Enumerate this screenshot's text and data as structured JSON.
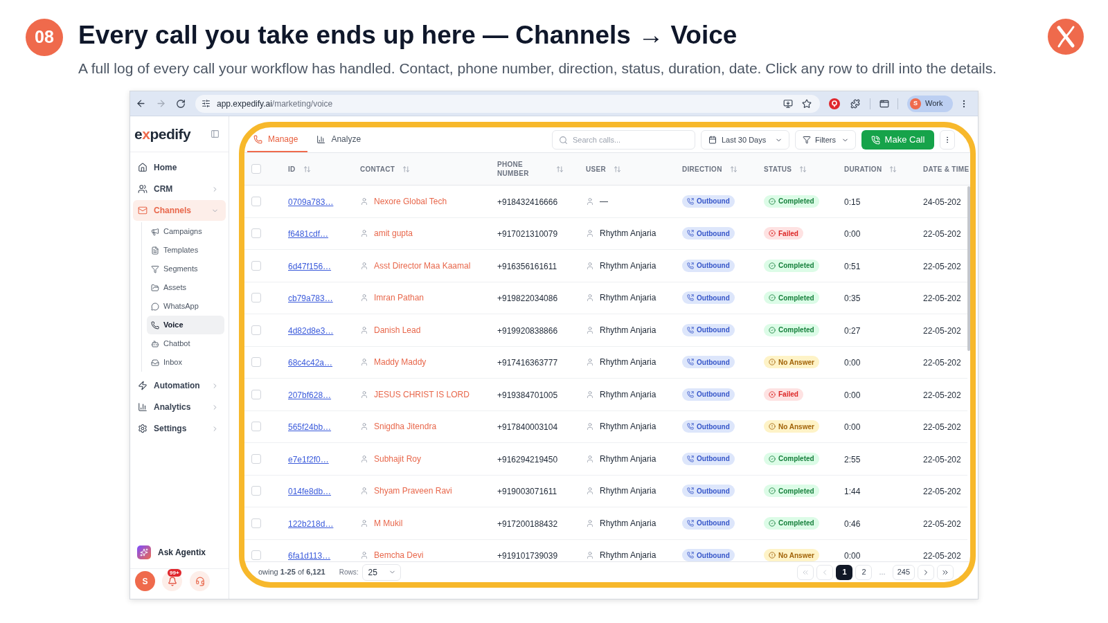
{
  "slide": {
    "number": "08",
    "title": "Every call you take ends up here — Channels → Voice",
    "subtitle": "A full log of every call your workflow has handled. Contact, phone number, direction, status, duration, date. Click any row to drill into the details."
  },
  "browser": {
    "back": {
      "disabled": false
    },
    "forward": {
      "disabled": true
    },
    "url_host": "app.expedify.ai",
    "url_path": "/marketing/voice",
    "profile": {
      "initial": "S",
      "label": "Work"
    }
  },
  "sidebar": {
    "logo": "expedify",
    "items": [
      {
        "label": "Home",
        "kind": "link",
        "selected": false
      },
      {
        "label": "CRM",
        "kind": "group",
        "selected": false,
        "expanded": false
      },
      {
        "label": "Channels",
        "kind": "group",
        "selected": true,
        "expanded": true,
        "children": [
          {
            "label": "Campaigns",
            "selected": false
          },
          {
            "label": "Templates",
            "selected": false
          },
          {
            "label": "Segments",
            "selected": false
          },
          {
            "label": "Assets",
            "selected": false
          },
          {
            "label": "WhatsApp",
            "selected": false
          },
          {
            "label": "Voice",
            "selected": true
          },
          {
            "label": "Chatbot",
            "selected": false
          },
          {
            "label": "Inbox",
            "selected": false
          }
        ]
      },
      {
        "label": "Automation",
        "kind": "group",
        "selected": false,
        "expanded": false
      },
      {
        "label": "Analytics",
        "kind": "group",
        "selected": false,
        "expanded": false
      },
      {
        "label": "Settings",
        "kind": "group",
        "selected": false,
        "expanded": false
      }
    ],
    "ask_label": "Ask Agentix",
    "user_initial": "S",
    "notification_count": "99+"
  },
  "main": {
    "tabs": [
      {
        "label": "Manage",
        "selected": true
      },
      {
        "label": "Analyze",
        "selected": false
      }
    ],
    "search": {
      "placeholder": "Search calls..."
    },
    "date_range": "Last 30 Days",
    "filters": "Filters",
    "make_call": "Make Call"
  },
  "table": {
    "select_all": {
      "checked": false
    },
    "columns": [
      {
        "label": "ID",
        "sortable": true
      },
      {
        "label": "CONTACT",
        "sortable": true
      },
      {
        "label": "PHONE NUMBER",
        "sortable": true
      },
      {
        "label": "USER",
        "sortable": true
      },
      {
        "label": "DIRECTION",
        "sortable": true
      },
      {
        "label": "STATUS",
        "sortable": true
      },
      {
        "label": "DURATION",
        "sortable": true
      },
      {
        "label": "DATE & TIME",
        "sortable": false
      }
    ],
    "rows": [
      {
        "checked": false,
        "id": "0709a783…",
        "contact": "Nexore Global Tech",
        "phone": "+918432416666",
        "user": "—",
        "direction": {
          "label": "Outbound",
          "kind": "outbound"
        },
        "status": {
          "label": "Completed",
          "kind": "completed"
        },
        "duration": "0:15",
        "date": "24-05-202"
      },
      {
        "checked": false,
        "id": "f6481cdf…",
        "contact": "amit gupta",
        "phone": "+917021310079",
        "user": "Rhythm Anjaria",
        "direction": {
          "label": "Outbound",
          "kind": "outbound"
        },
        "status": {
          "label": "Failed",
          "kind": "failed"
        },
        "duration": "0:00",
        "date": "22-05-202"
      },
      {
        "checked": false,
        "id": "6d47f156…",
        "contact": "Asst Director Maa Kaamal",
        "phone": "+916356161611",
        "user": "Rhythm Anjaria",
        "direction": {
          "label": "Outbound",
          "kind": "outbound"
        },
        "status": {
          "label": "Completed",
          "kind": "completed"
        },
        "duration": "0:51",
        "date": "22-05-202"
      },
      {
        "checked": false,
        "id": "cb79a783…",
        "contact": "Imran Pathan",
        "phone": "+919822034086",
        "user": "Rhythm Anjaria",
        "direction": {
          "label": "Outbound",
          "kind": "outbound"
        },
        "status": {
          "label": "Completed",
          "kind": "completed"
        },
        "duration": "0:35",
        "date": "22-05-202"
      },
      {
        "checked": false,
        "id": "4d82d8e3…",
        "contact": "Danish Lead",
        "phone": "+919920838866",
        "user": "Rhythm Anjaria",
        "direction": {
          "label": "Outbound",
          "kind": "outbound"
        },
        "status": {
          "label": "Completed",
          "kind": "completed"
        },
        "duration": "0:27",
        "date": "22-05-202"
      },
      {
        "checked": false,
        "id": "68c4c42a…",
        "contact": "Maddy Maddy",
        "phone": "+917416363777",
        "user": "Rhythm Anjaria",
        "direction": {
          "label": "Outbound",
          "kind": "outbound"
        },
        "status": {
          "label": "No Answer",
          "kind": "no_answer"
        },
        "duration": "0:00",
        "date": "22-05-202"
      },
      {
        "checked": false,
        "id": "207bf628…",
        "contact": "JESUS CHRIST IS LORD",
        "phone": "+919384701005",
        "user": "Rhythm Anjaria",
        "direction": {
          "label": "Outbound",
          "kind": "outbound"
        },
        "status": {
          "label": "Failed",
          "kind": "failed"
        },
        "duration": "0:00",
        "date": "22-05-202"
      },
      {
        "checked": false,
        "id": "565f24bb…",
        "contact": "Snigdha Jitendra",
        "phone": "+917840003104",
        "user": "Rhythm Anjaria",
        "direction": {
          "label": "Outbound",
          "kind": "outbound"
        },
        "status": {
          "label": "No Answer",
          "kind": "no_answer"
        },
        "duration": "0:00",
        "date": "22-05-202"
      },
      {
        "checked": false,
        "id": "e7e1f2f0…",
        "contact": "Subhajit Roy",
        "phone": "+916294219450",
        "user": "Rhythm Anjaria",
        "direction": {
          "label": "Outbound",
          "kind": "outbound"
        },
        "status": {
          "label": "Completed",
          "kind": "completed"
        },
        "duration": "2:55",
        "date": "22-05-202"
      },
      {
        "checked": false,
        "id": "014fe8db…",
        "contact": "Shyam Praveen Ravi",
        "phone": "+919003071611",
        "user": "Rhythm Anjaria",
        "direction": {
          "label": "Outbound",
          "kind": "outbound"
        },
        "status": {
          "label": "Completed",
          "kind": "completed"
        },
        "duration": "1:44",
        "date": "22-05-202"
      },
      {
        "checked": false,
        "id": "122b218d…",
        "contact": "M Mukil",
        "phone": "+917200188432",
        "user": "Rhythm Anjaria",
        "direction": {
          "label": "Outbound",
          "kind": "outbound"
        },
        "status": {
          "label": "Completed",
          "kind": "completed"
        },
        "duration": "0:46",
        "date": "22-05-202"
      },
      {
        "checked": false,
        "id": "6fa1d113…",
        "contact": "Bemcha Devi",
        "phone": "+919101739039",
        "user": "Rhythm Anjaria",
        "direction": {
          "label": "Outbound",
          "kind": "outbound"
        },
        "status": {
          "label": "No Answer",
          "kind": "no_answer"
        },
        "duration": "0:00",
        "date": "22-05-202"
      }
    ]
  },
  "footer": {
    "showing": "owing **1-25** of **6,121**",
    "rows_label": "Rows:",
    "rows_value": "25",
    "nav": {
      "first": {
        "disabled": true
      },
      "prev": {
        "disabled": true
      },
      "next": {
        "disabled": false
      },
      "last": {
        "disabled": false
      }
    },
    "pages": [
      {
        "label": "1",
        "selected": true
      },
      {
        "label": "2",
        "selected": false
      },
      {
        "label": "245",
        "selected": false
      }
    ],
    "gap": "..."
  }
}
